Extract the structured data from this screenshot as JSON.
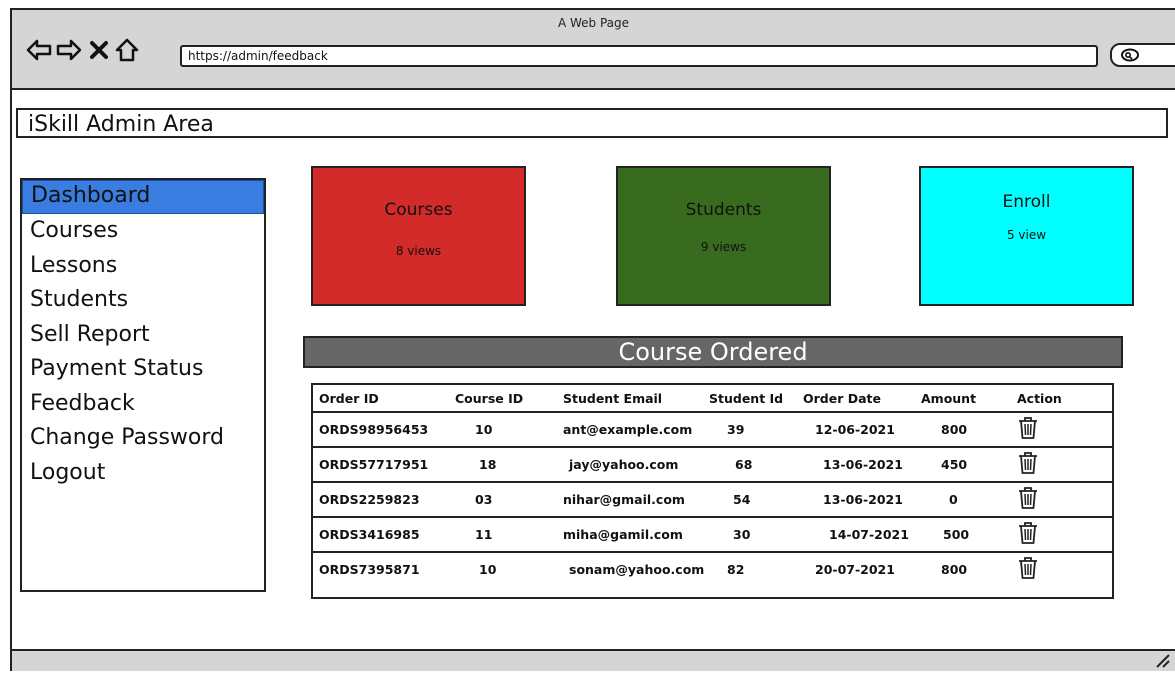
{
  "browser": {
    "window_title": "A Web Page",
    "url": "https://admin/feedback"
  },
  "app": {
    "title": "iSkill Admin Area"
  },
  "sidebar": {
    "items": [
      {
        "label": "Dashboard",
        "active": true
      },
      {
        "label": "Courses"
      },
      {
        "label": "Lessons"
      },
      {
        "label": "Students"
      },
      {
        "label": "Sell Report"
      },
      {
        "label": "Payment Status"
      },
      {
        "label": "Feedback"
      },
      {
        "label": "Change Password"
      },
      {
        "label": "Logout"
      }
    ]
  },
  "cards": [
    {
      "title": "Courses",
      "subtitle": "8 views",
      "color": "#d32a2a"
    },
    {
      "title": "Students",
      "subtitle": "9 views",
      "color": "#386b1e"
    },
    {
      "title": "Enroll",
      "subtitle": "5 view",
      "color": "#00ffff"
    }
  ],
  "orders": {
    "heading": "Course Ordered",
    "columns": [
      "Order ID",
      "Course ID",
      "Student Email",
      "Student Id",
      "Order Date",
      "Amount",
      "Action"
    ],
    "rows": [
      [
        "ORDS98956453",
        "10",
        "ant@example.com",
        "39",
        "12-06-2021",
        "800"
      ],
      [
        "ORDS57717951",
        "18",
        "jay@yahoo.com",
        "68",
        "13-06-2021",
        "450"
      ],
      [
        "ORDS2259823",
        "03",
        "nihar@gmail.com",
        "54",
        "13-06-2021",
        "0"
      ],
      [
        "ORDS3416985",
        "11",
        "miha@gamil.com",
        "30",
        "14-07-2021",
        "500"
      ],
      [
        "ORDS7395871",
        "10",
        "sonam@yahoo.com",
        "82",
        "20-07-2021",
        "800"
      ]
    ],
    "action_icon": "trash-icon"
  }
}
